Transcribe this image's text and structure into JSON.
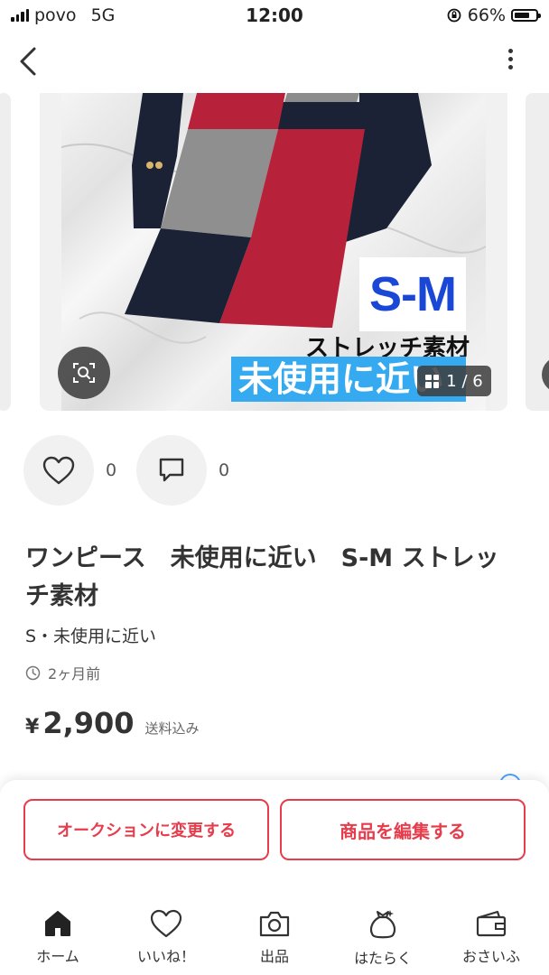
{
  "status_bar": {
    "carrier": "povo",
    "network": "5G",
    "time": "12:00",
    "battery_percent": "66%",
    "battery_level": 0.66
  },
  "nav": {
    "back_icon": "chevron-left-icon",
    "menu_icon": "more-vertical-icon"
  },
  "gallery": {
    "overlay_size": "S-M",
    "overlay_material": "ストレッチ素材",
    "overlay_condition": "未使用に近い",
    "counter": "1 / 6",
    "zoom_icon": "image-search-icon",
    "counter_icon": "grid-icon"
  },
  "reactions": {
    "like_count": "0",
    "comment_count": "0",
    "like_icon": "heart-icon",
    "comment_icon": "comment-icon"
  },
  "item": {
    "title": "ワンピース　未使用に近い　S-M ストレッチ素材",
    "subtitle": "S・未使用に近い",
    "posted_ago": "2ヶ月前",
    "currency": "¥",
    "price": "2,900",
    "shipping_note": "送料込み"
  },
  "actions": {
    "auction_button": "オークションに変更する",
    "edit_button": "商品を編集する"
  },
  "tabs": [
    {
      "label": "ホーム",
      "icon": "home-icon",
      "active": true
    },
    {
      "label": "いいね！",
      "icon": "heart-icon",
      "active": false
    },
    {
      "label": "出品",
      "icon": "camera-icon",
      "active": false
    },
    {
      "label": "はたらく",
      "icon": "money-bag-icon",
      "active": false
    },
    {
      "label": "おさいふ",
      "icon": "wallet-icon",
      "active": false
    }
  ],
  "colors": {
    "accent_red": "#e73c4b",
    "overlay_blue": "#1a47d6",
    "band_blue": "#36aaf0"
  }
}
